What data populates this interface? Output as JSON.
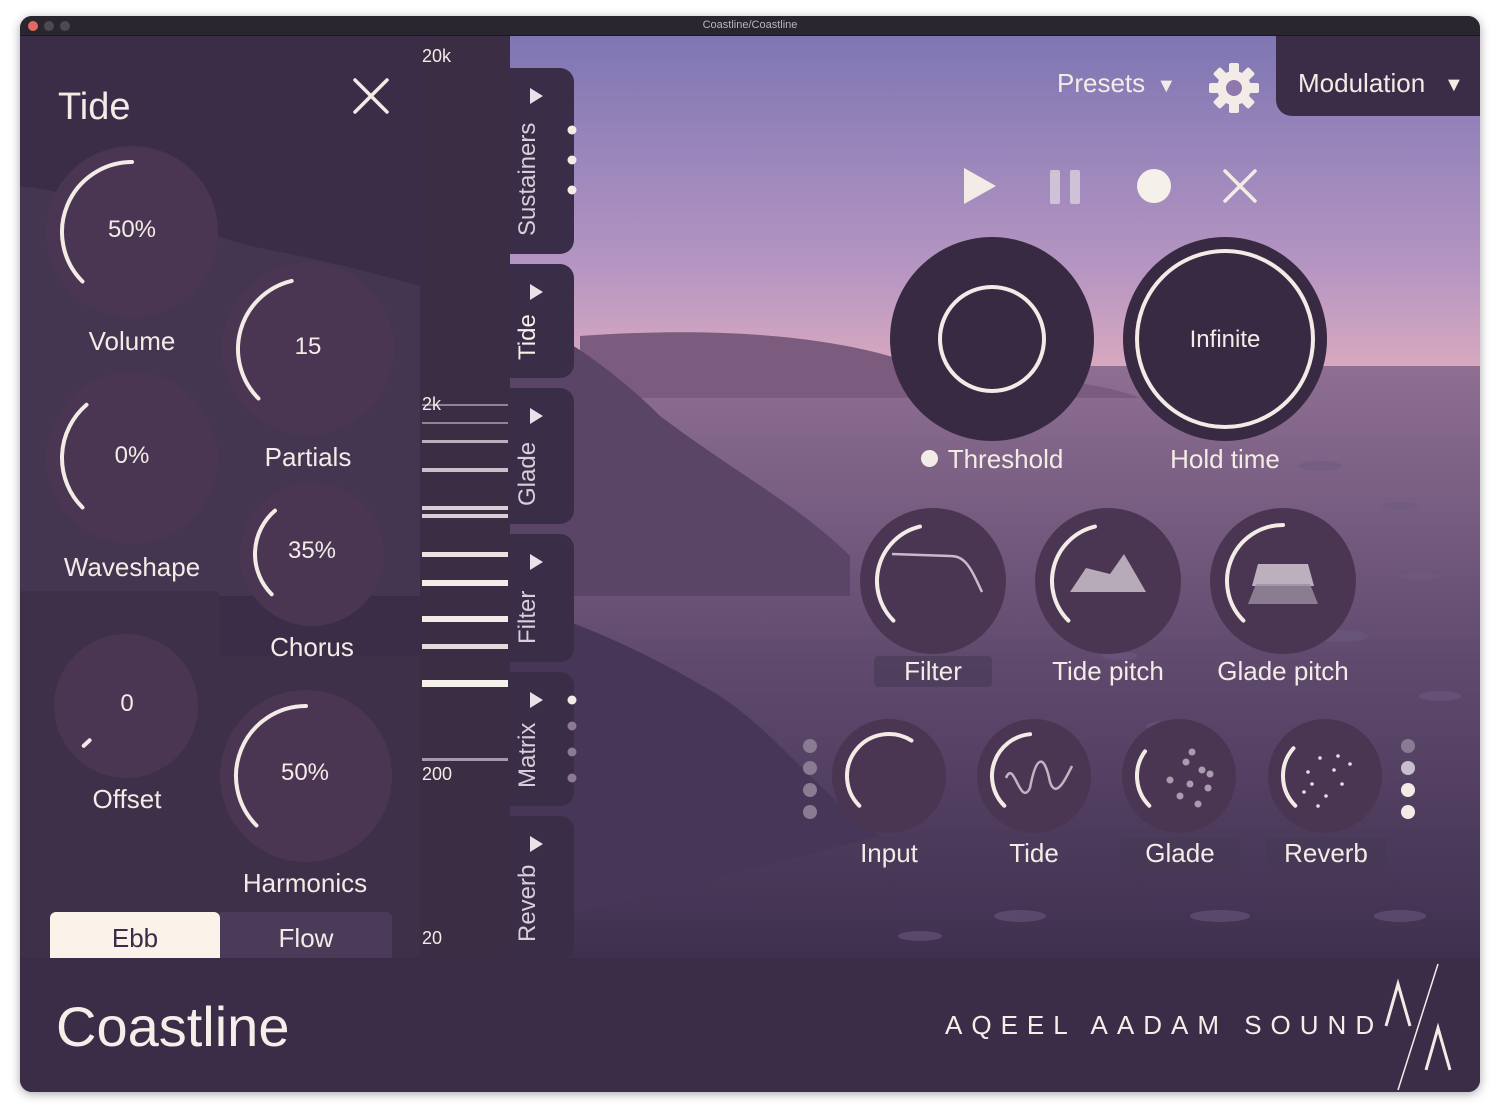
{
  "window": {
    "title": "Coastline/Coastline"
  },
  "tide_panel": {
    "title": "Tide",
    "knobs": {
      "volume": {
        "label": "Volume",
        "value": "50%",
        "level": 0.5
      },
      "partials": {
        "label": "Partials",
        "value": "15",
        "level": 0.45
      },
      "waveshape": {
        "label": "Waveshape",
        "value": "0%",
        "level": 0.35
      },
      "chorus": {
        "label": "Chorus",
        "value": "35%",
        "level": 0.35
      },
      "offset": {
        "label": "Offset",
        "value": "0",
        "level": 0.0
      },
      "harmonics": {
        "label": "Harmonics",
        "value": "50%",
        "level": 0.5
      }
    },
    "mode": {
      "options": [
        "Ebb",
        "Flow"
      ],
      "selected": "Ebb"
    }
  },
  "spectrum": {
    "labels": [
      "20k",
      "2k",
      "200",
      "20"
    ]
  },
  "side_tabs": [
    "Sustainers",
    "Tide",
    "Glade",
    "Filter",
    "Matrix",
    "Reverb"
  ],
  "header": {
    "presets_label": "Presets",
    "modulation_label": "Modulation"
  },
  "transport": [
    "play",
    "pause",
    "record",
    "clear"
  ],
  "main": {
    "threshold": {
      "label": "Threshold"
    },
    "hold_time": {
      "label": "Hold time",
      "value": "Infinite"
    },
    "row1": [
      "Filter",
      "Tide pitch",
      "Glade pitch"
    ],
    "row2": [
      "Input",
      "Tide",
      "Glade",
      "Reverb"
    ]
  },
  "footer": {
    "app_name": "Coastline",
    "brand": "AQEEL AADAM SOUND"
  },
  "colors": {
    "knob": "#4a3653",
    "panel": "#362a42",
    "text": "#f3ece6",
    "selected_seg": "#fbf3ea"
  }
}
